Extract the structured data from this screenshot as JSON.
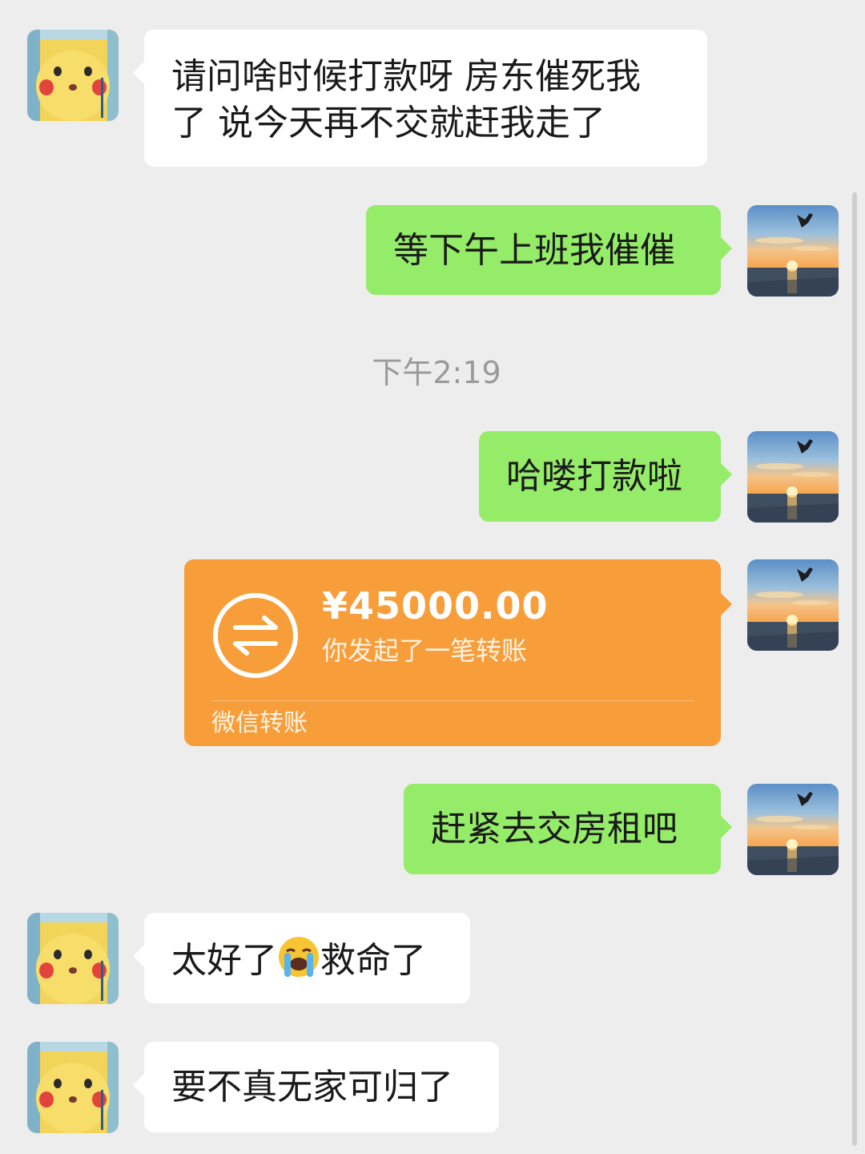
{
  "messages": {
    "m1": {
      "text": "请问啥时候打款呀  房东催死我了 说今天再不交就赶我走了",
      "line1": "请问啥时候打款呀  房东催死我",
      "line2": "了 说今天再不交就赶我走了"
    },
    "m2": {
      "text": "等下午上班我催催"
    },
    "timestamp": "下午2:19",
    "m3": {
      "text": "哈喽打款啦"
    },
    "transfer": {
      "amount": "¥45000.00",
      "description": "你发起了一笔转账",
      "label": "微信转账",
      "icon": "transfer-arrows-icon",
      "color": "#f79e3b"
    },
    "m4": {
      "text": "赶紧去交房租吧"
    },
    "m5": {
      "before": "太好了",
      "emoji": "loudly-crying-face-emoji",
      "after": "救命了"
    },
    "m6": {
      "text": "要不真无家可归了"
    }
  },
  "avatars": {
    "contact": "pikachu-avatar",
    "self": "sunset-seagull-avatar"
  },
  "colors": {
    "background": "#ededed",
    "outgoing_bubble": "#95ec69",
    "incoming_bubble": "#ffffff",
    "timestamp": "#9a9a9a"
  }
}
